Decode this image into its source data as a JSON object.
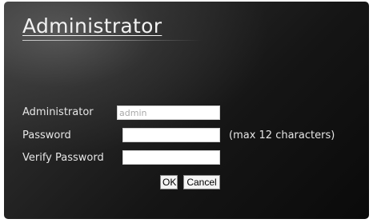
{
  "page": {
    "title": "Administrator"
  },
  "form": {
    "admin_label": "Administrator",
    "admin_value": "admin",
    "password_label": "Password",
    "password_value": "",
    "password_hint": "(max 12 characters)",
    "verify_label": "Verify Password",
    "verify_value": ""
  },
  "buttons": {
    "ok_label": "OK",
    "cancel_label": "Cancel"
  },
  "colors": {
    "background_dark": "#151515",
    "text_light": "#e6e6e6",
    "readonly_text": "#a8a8a8"
  }
}
